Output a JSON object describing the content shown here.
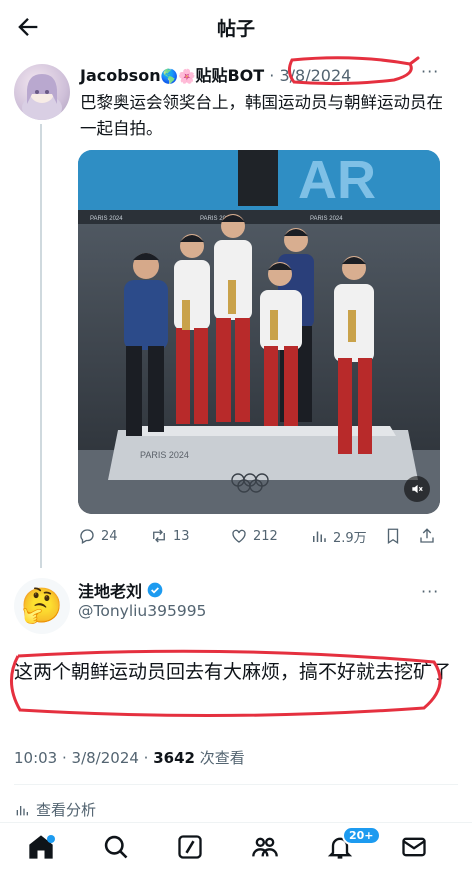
{
  "header": {
    "title": "帖子"
  },
  "post": {
    "author_name": "Jacobson",
    "author_emojis": "🌎🌸",
    "author_suffix": "贴贴BOT",
    "date": "· 3/8/2024",
    "text": "巴黎奥运会领奖台上，韩国运动员与朝鲜运动员在一起自拍。",
    "media": {
      "type": "video",
      "banner_text": "PARIS 2024",
      "podium_text": "PARIS 2024",
      "bg_letters": "AR",
      "controls": {
        "mute_icon": "speaker-muted-icon"
      }
    },
    "actions": {
      "replies": "24",
      "reposts": "13",
      "likes": "212",
      "views": "2.9万"
    }
  },
  "reply": {
    "author_name": "洼地老刘",
    "avatar": "🤔",
    "handle": "@Tonyliu395995",
    "text": "这两个朝鲜运动员回去有大麻烦，搞不好就去挖矿了",
    "time": "10:03 · 3/8/2024 · ",
    "views_count": "3642",
    "views_label": " 次查看",
    "analytics_label": "查看分析"
  },
  "nav": {
    "notifications_badge": "20+"
  },
  "colors": {
    "accent": "#1d9bf0",
    "annotation_red": "#e5303f",
    "muted": "#536471"
  }
}
